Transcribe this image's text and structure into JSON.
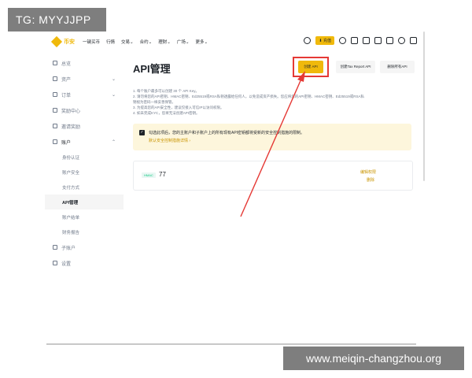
{
  "watermark_top": "TG: MYYJJPP",
  "watermark_bottom": "www.meiqin-changzhou.org",
  "topbar": {
    "brand": "币安",
    "nav": [
      "一键买币",
      "行情",
      "交易",
      "合约",
      "理财",
      "广场",
      "更多"
    ],
    "deposit_label": "充值"
  },
  "sidebar": {
    "items": [
      {
        "label": "总览"
      },
      {
        "label": "资产"
      },
      {
        "label": "订单"
      },
      {
        "label": "奖励中心"
      },
      {
        "label": "邀请奖励"
      },
      {
        "label": "账户"
      }
    ],
    "account_sub": [
      "身份认证",
      "账户安全",
      "支付方式",
      "API管理",
      "账户结单",
      "财务报告"
    ],
    "bottom": [
      {
        "label": "子账户"
      },
      {
        "label": "设置"
      }
    ]
  },
  "main": {
    "title": "API管理",
    "create_btn": "创建 API",
    "tax_btn": "创建Tax Report API",
    "delete_btn": "删除所有API",
    "notes": [
      "1. 每个账户最多可以创建 30 个 API Key。",
      "2. 请勿将您的API密钥、HMAC密钥、Ed25519或RSA私钥透露给任何人，以免造成资产损失。您应将您的API密钥、HMAC密钥、Ed25519或RSA私",
      "钥视为密码一样妥善保管。",
      "3. 为提高您的API安全性，建议仅接入可信IP以访问权限。",
      "4. 如未完成KYC，您将无法创建API密钥。"
    ],
    "warning_text": "勾选此项后，您的主账户和子账户上的所有现有API密钥都将受新的安全控制措施的限制。",
    "warning_link": "默认安全控制措施详情 ›",
    "api_card": {
      "tag": "HMAC",
      "name": "77",
      "edit": "编辑权限",
      "delete": "删除"
    }
  },
  "colors": {
    "accent": "#f0b90b",
    "highlight": "#e53935"
  }
}
